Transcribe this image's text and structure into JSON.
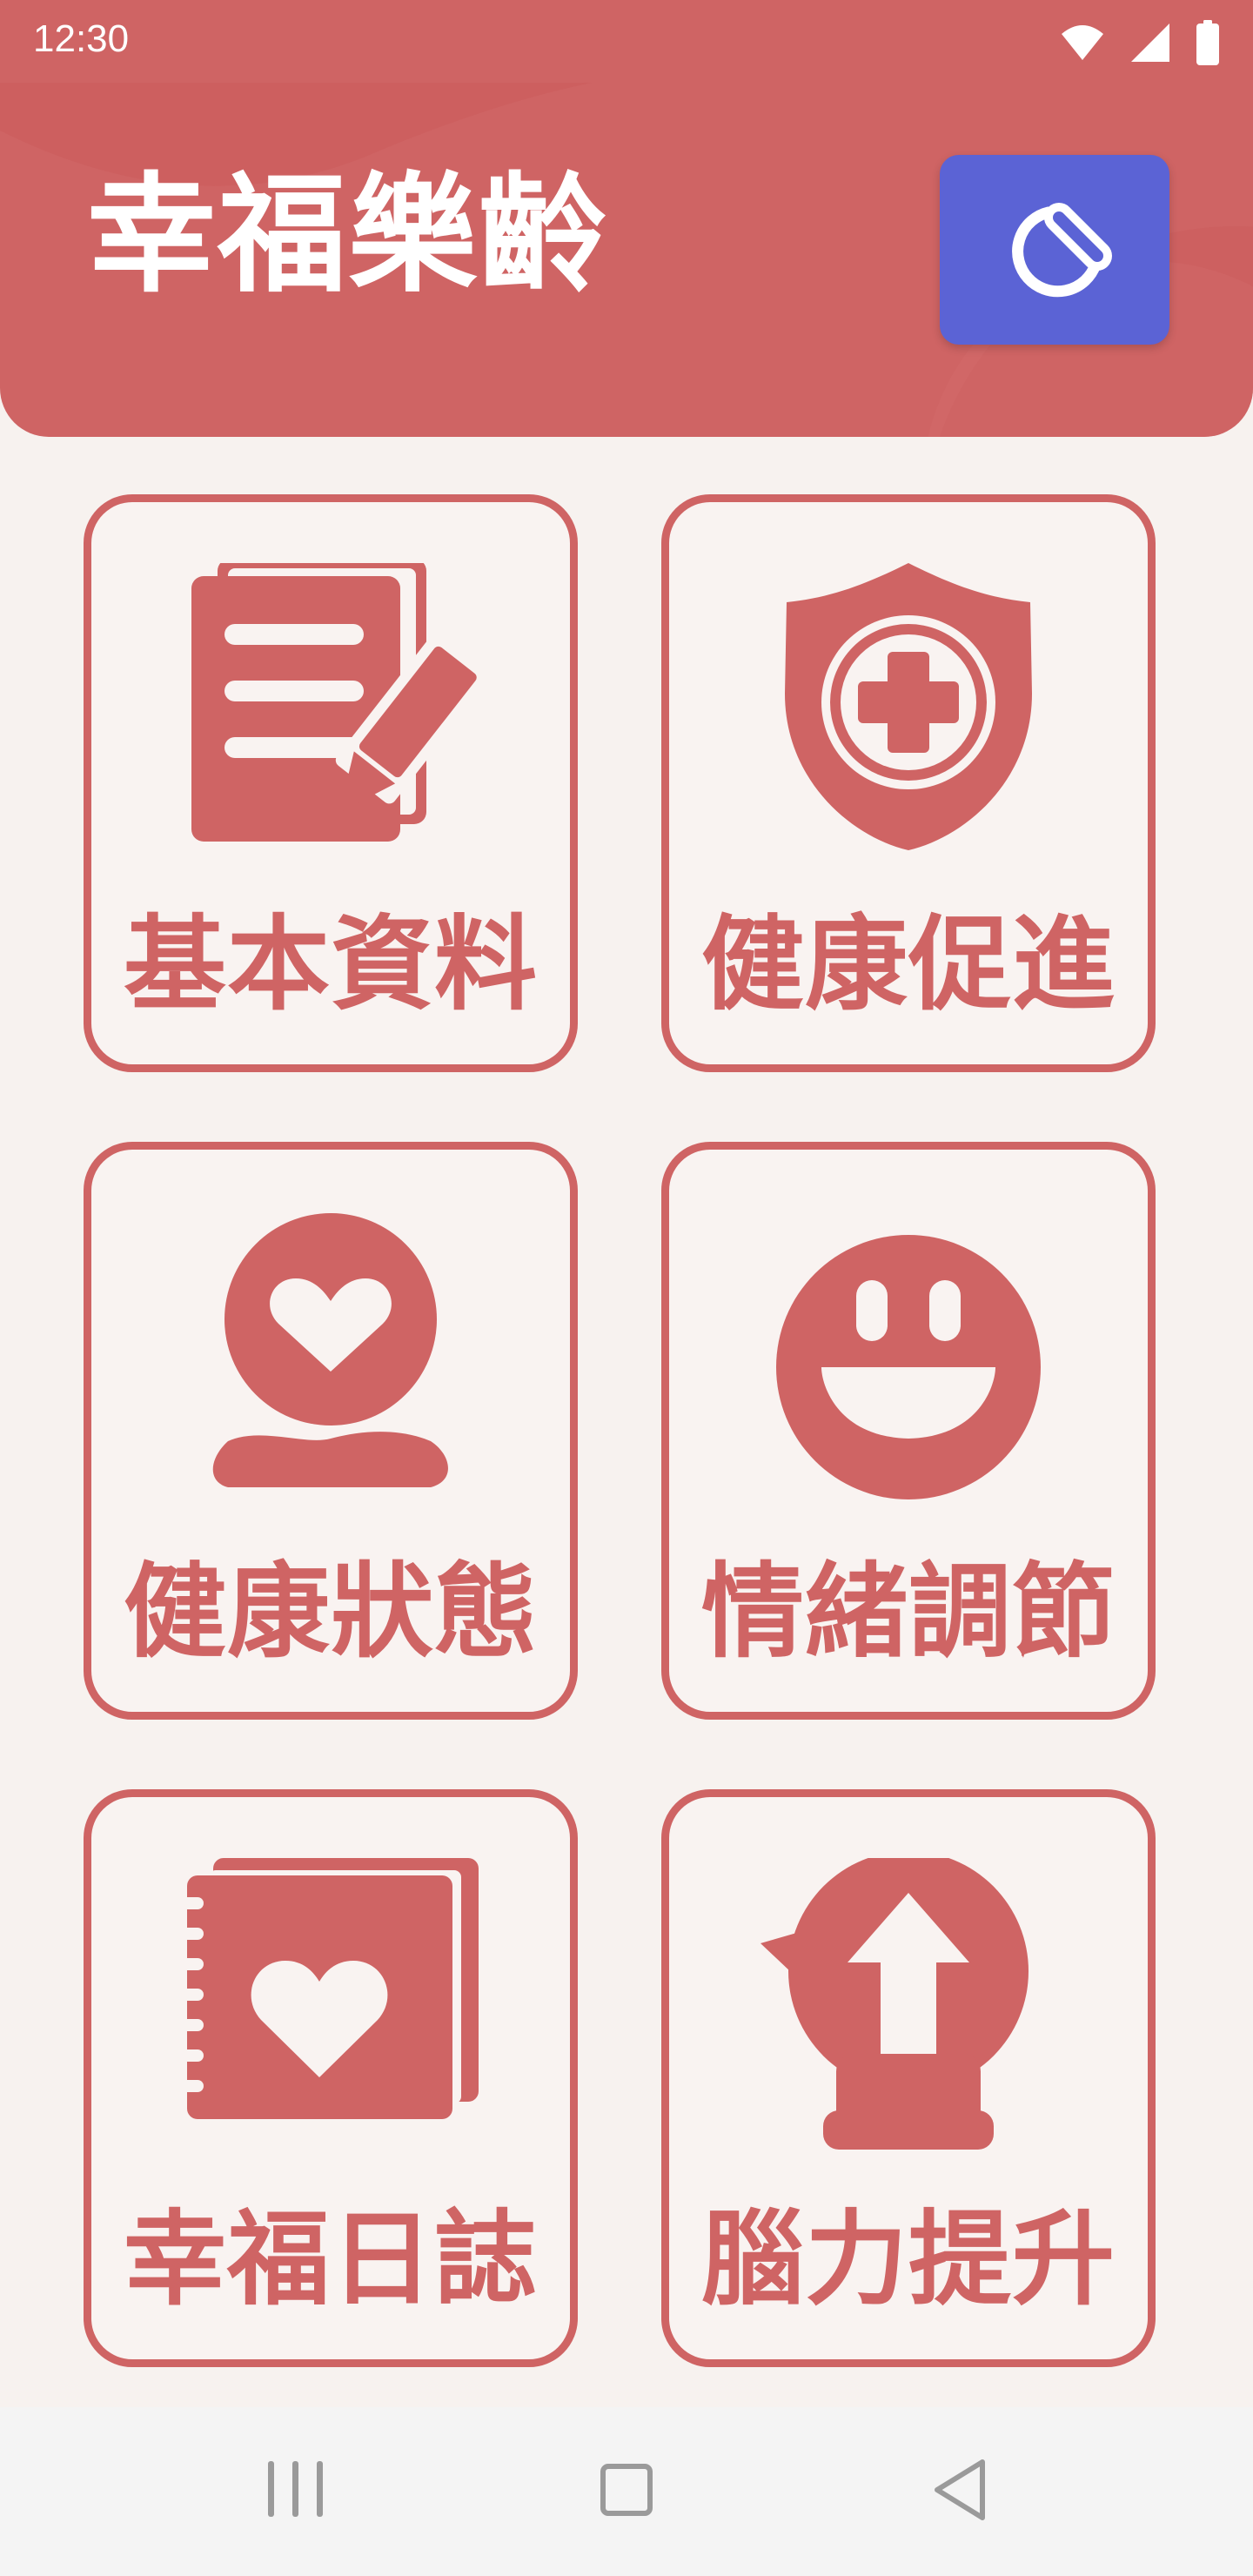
{
  "status_bar": {
    "time": "12:30",
    "icons": [
      "wifi-icon",
      "signal-icon",
      "battery-icon"
    ]
  },
  "header": {
    "title": "幸福樂齡",
    "action_icon": "clock-pen-icon"
  },
  "menu": {
    "items": [
      {
        "label": "基本資料",
        "icon": "document-pen-icon"
      },
      {
        "label": "健康促進",
        "icon": "shield-plus-icon"
      },
      {
        "label": "健康狀態",
        "icon": "person-heart-icon"
      },
      {
        "label": "情緒調節",
        "icon": "smiley-icon"
      },
      {
        "label": "幸福日誌",
        "icon": "heart-notebook-icon"
      },
      {
        "label": "腦力提升",
        "icon": "lightbulb-arrow-icon"
      }
    ]
  },
  "nav_bar": {
    "buttons": [
      "recent-apps-icon",
      "home-icon",
      "back-icon"
    ]
  },
  "colors": {
    "accent": "#cf6464",
    "background": "#f7f2ef",
    "action_button": "#5b63d5",
    "nav_background": "#f4f4f4"
  }
}
